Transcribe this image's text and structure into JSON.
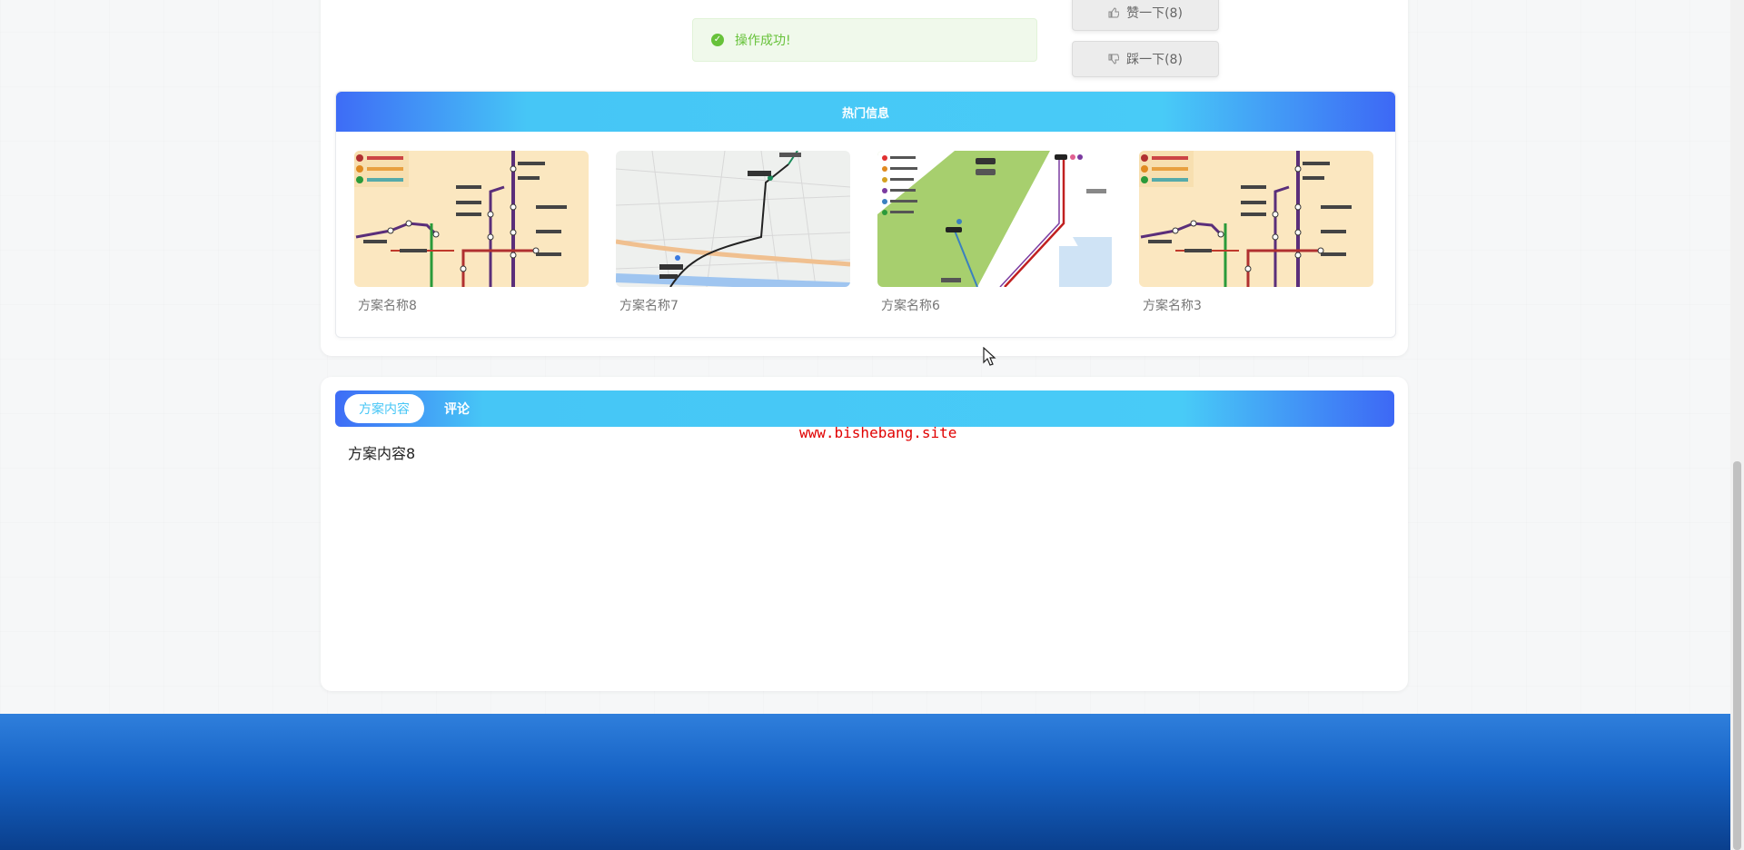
{
  "toast": {
    "message": "操作成功!"
  },
  "votes": {
    "like_label": "赞一下(8)",
    "dislike_label": "踩一下(8)"
  },
  "hot": {
    "title": "热门信息",
    "items": [
      {
        "name": "方案名称8",
        "image_kind": "metro-map"
      },
      {
        "name": "方案名称7",
        "image_kind": "street-map"
      },
      {
        "name": "方案名称6",
        "image_kind": "transit-map"
      },
      {
        "name": "方案名称3",
        "image_kind": "metro-map"
      }
    ]
  },
  "tabs": [
    {
      "label": "方案内容",
      "active": true
    },
    {
      "label": "评论",
      "active": false
    }
  ],
  "content": {
    "text": "方案内容8"
  },
  "watermark": "www.bishebang.site",
  "colors": {
    "accent_blue": "#48cbf7",
    "gradient_edge": "#3e6cf6",
    "success_green": "#67c23a",
    "footer_blue": "#1662c4"
  }
}
